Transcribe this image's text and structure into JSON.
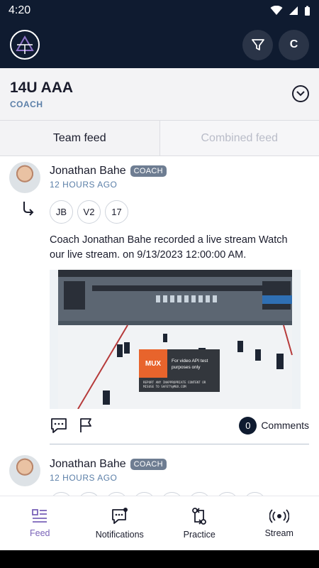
{
  "status_bar": {
    "time": "4:20"
  },
  "app_bar": {
    "filter_icon": "filter-icon",
    "profile_initial": "C"
  },
  "team": {
    "name": "14U AAA",
    "role": "COACH"
  },
  "tabs": [
    {
      "label": "Team feed",
      "active": true
    },
    {
      "label": "Combined feed",
      "active": false
    }
  ],
  "posts": [
    {
      "author": "Jonathan Bahe",
      "badge": "COACH",
      "time": "12 HOURS AGO",
      "chips": [
        "JB",
        "V2",
        "17"
      ],
      "text": "Coach Jonathan Bahe recorded a live stream Watch our live stream. on 9/13/2023 12:00:00 AM.",
      "video": {
        "mux_label": "MUX",
        "mux_note": "For video API test purposes only",
        "report_text": "REPORT ANY INAPPROPRIATE CONTENT OR MISUSE TO SAFETY@MUX.COM"
      },
      "comments_count": "0",
      "comments_label": "Comments"
    },
    {
      "author": "Jonathan Bahe",
      "badge": "COACH",
      "time": "12 HOURS AGO"
    }
  ],
  "bottom_nav": [
    {
      "label": "Feed",
      "icon": "feed-icon",
      "active": true
    },
    {
      "label": "Notifications",
      "icon": "notifications-icon",
      "active": false
    },
    {
      "label": "Practice",
      "icon": "practice-icon",
      "active": false
    },
    {
      "label": "Stream",
      "icon": "stream-icon",
      "active": false
    }
  ],
  "colors": {
    "header_bg": "#0f1b30",
    "accent": "#7a63b8",
    "meta": "#5b7fa8"
  }
}
